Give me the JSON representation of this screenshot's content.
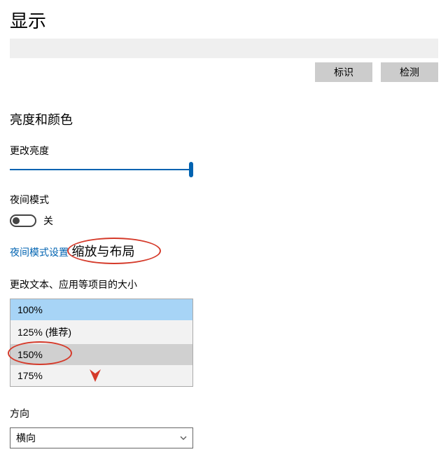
{
  "page": {
    "title": "显示"
  },
  "buttons": {
    "identify": "标识",
    "detect": "检测"
  },
  "brightness": {
    "section_title": "亮度和颜色",
    "slider_label": "更改亮度"
  },
  "night_light": {
    "label": "夜间模式",
    "state": "关",
    "settings_link": "夜间模式设置"
  },
  "scaling": {
    "section_title": "缩放与布局",
    "label": "更改文本、应用等项目的大小",
    "options": {
      "o100": "100%",
      "o125": "125% (推荐)",
      "o150": "150%",
      "o175": "175%"
    }
  },
  "orientation": {
    "label": "方向",
    "value": "横向"
  },
  "colors": {
    "accent": "#0063b1",
    "annotation": "#d53a2a"
  }
}
